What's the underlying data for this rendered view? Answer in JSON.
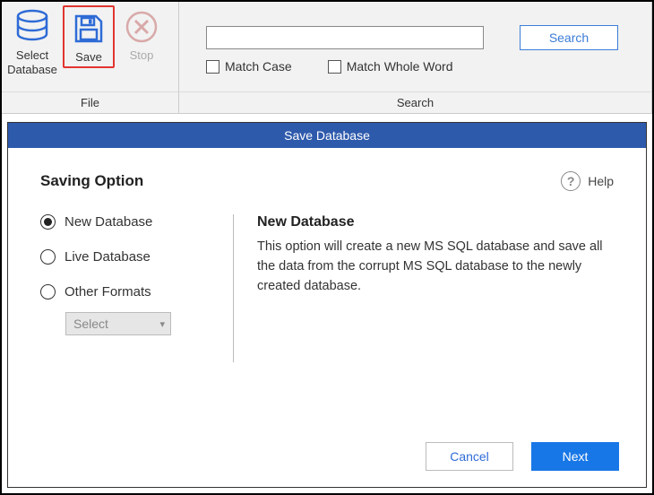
{
  "ribbon": {
    "file_group_label": "File",
    "search_group_label": "Search",
    "select_database_label": "Select Database",
    "save_label": "Save",
    "stop_label": "Stop",
    "search_button": "Search",
    "match_case": "Match Case",
    "match_whole": "Match Whole Word",
    "search_value": ""
  },
  "dialog": {
    "title": "Save Database",
    "heading": "Saving Option",
    "help_label": "Help",
    "options": [
      {
        "label": "New Database",
        "selected": true
      },
      {
        "label": "Live Database",
        "selected": false
      },
      {
        "label": "Other Formats",
        "selected": false
      }
    ],
    "select_placeholder": "Select",
    "detail_title": "New Database",
    "detail_desc": "This option will create a new MS SQL database and save all the data from the corrupt MS SQL database to the newly created database.",
    "cancel": "Cancel",
    "next": "Next"
  }
}
